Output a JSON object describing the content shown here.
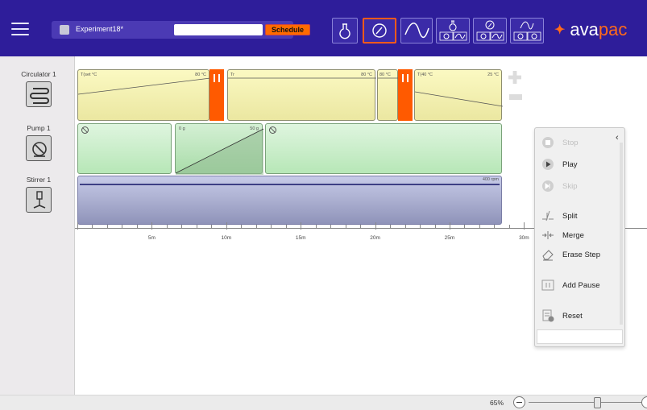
{
  "header": {
    "menu_icon": "hamburger-menu-icon",
    "experiment_name": "Experiment18*",
    "schedule_placeholder": "",
    "schedule_label": "Schedule",
    "brand_left": "ava",
    "brand_right": "pac",
    "colors": {
      "bar": "#2e1d9a",
      "accent": "#ff6a00"
    },
    "tools": [
      {
        "name": "flask-icon",
        "active": false
      },
      {
        "name": "gauge-icon",
        "active": true
      },
      {
        "name": "wave-icon",
        "active": false
      },
      {
        "name": "flask-pump-wave-icon",
        "active": false
      },
      {
        "name": "gauge-flask-wave-icon",
        "active": false
      },
      {
        "name": "wave-flask-gauge-icon",
        "active": false
      }
    ]
  },
  "devices": [
    {
      "label": "Circulator 1",
      "icon": "coil-icon"
    },
    {
      "label": "Pump 1",
      "icon": "pump-icon"
    },
    {
      "label": "Stirrer 1",
      "icon": "stirrer-icon"
    }
  ],
  "lanes": {
    "circulator": {
      "segments": [
        {
          "left_label": "T(set °C",
          "right_label": "80 °C"
        },
        {
          "left_label": "Tr",
          "right_label": "80 °C"
        },
        {
          "left_label": "80 °C",
          "right_label": ""
        },
        {
          "left_label": "T(40 °C",
          "right_label": "25 °C"
        }
      ]
    },
    "pump": {
      "segments": [
        {
          "left_label": "",
          "right_label": ""
        },
        {
          "left_label": "0 g",
          "right_label": "50 g"
        },
        {
          "left_label": "",
          "right_label": ""
        }
      ]
    },
    "stirrer": {
      "right_label": "400 rpm"
    }
  },
  "ruler": {
    "labels": [
      "5m",
      "10m",
      "15m",
      "20m",
      "25m",
      "30m"
    ]
  },
  "context_menu": {
    "items": [
      {
        "label": "Stop",
        "icon": "stop-icon",
        "enabled": false
      },
      {
        "label": "Play",
        "icon": "play-icon",
        "enabled": true
      },
      {
        "label": "Skip",
        "icon": "skip-icon",
        "enabled": false
      },
      {
        "label": "Split",
        "icon": "split-icon",
        "enabled": true
      },
      {
        "label": "Merge",
        "icon": "merge-icon",
        "enabled": true
      },
      {
        "label": "Erase Step",
        "icon": "eraser-icon",
        "enabled": true
      },
      {
        "label": "Add Pause",
        "icon": "pause-icon",
        "enabled": true
      },
      {
        "label": "Reset",
        "icon": "reset-icon",
        "enabled": true
      }
    ]
  },
  "status": {
    "zoom": "65%"
  }
}
